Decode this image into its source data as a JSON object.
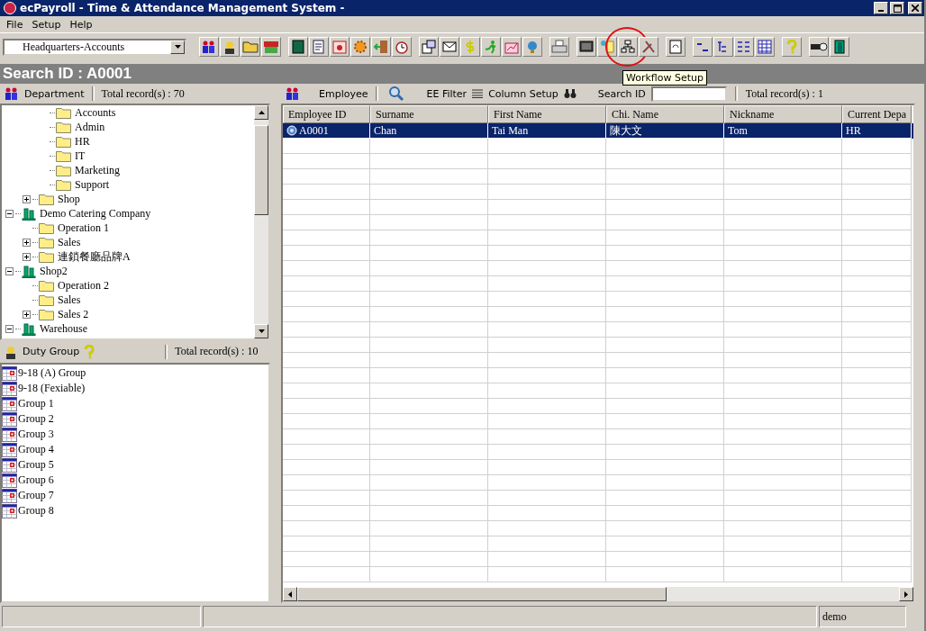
{
  "window": {
    "title": "ecPayroll - Time & Attendance Management System -"
  },
  "menu": [
    "File",
    "Setup",
    "Help"
  ],
  "toolbar": {
    "dropdown": {
      "value": "Headquarters-Accounts"
    },
    "groups": [
      [
        {
          "kind": "people"
        },
        {
          "kind": "person"
        },
        {
          "kind": "folder"
        },
        {
          "kind": "shop"
        }
      ],
      [
        {
          "kind": "book"
        },
        {
          "kind": "document"
        },
        {
          "kind": "calendar"
        },
        {
          "kind": "gear"
        },
        {
          "kind": "door"
        },
        {
          "kind": "clock"
        }
      ],
      [
        {
          "kind": "window"
        },
        {
          "kind": "mail"
        },
        {
          "kind": "dollar"
        },
        {
          "kind": "runner"
        },
        {
          "kind": "chart"
        },
        {
          "kind": "globe"
        }
      ],
      [
        {
          "kind": "printer"
        }
      ],
      [
        {
          "kind": "monitor"
        },
        {
          "kind": "tools"
        },
        {
          "kind": "workflow",
          "tooltip": "Workflow Setup"
        },
        {
          "kind": "wrench"
        }
      ],
      [
        {
          "kind": "page"
        }
      ],
      [
        {
          "kind": "list"
        },
        {
          "kind": "tree"
        },
        {
          "kind": "outline"
        },
        {
          "kind": "table"
        }
      ],
      [
        {
          "kind": "help"
        }
      ],
      [
        {
          "kind": "key"
        },
        {
          "kind": "exit"
        }
      ]
    ]
  },
  "search_banner": "Search ID : A0001",
  "department_panel": {
    "title": "Department",
    "total": "Total record(s) : 70",
    "tree": [
      {
        "children": [
          {
            "children": [
              {
                "label": "Accounts",
                "kind": "folder"
              },
              {
                "label": "Admin",
                "kind": "folder"
              },
              {
                "label": "HR",
                "kind": "folder"
              },
              {
                "label": "IT",
                "kind": "folder"
              },
              {
                "label": "Marketing",
                "kind": "folder"
              },
              {
                "label": "Support",
                "kind": "folder"
              }
            ]
          },
          {
            "label": "Shop",
            "kind": "folder",
            "expanded": false
          }
        ]
      },
      {
        "label": "Demo Catering Company",
        "kind": "company",
        "expanded": true,
        "children": [
          {
            "label": "Operation 1",
            "kind": "folder"
          },
          {
            "label": "Sales",
            "kind": "folder",
            "expanded": false
          },
          {
            "label": "連鎖餐廳品牌A",
            "kind": "folder",
            "expanded": false
          }
        ]
      },
      {
        "label": "Shop2",
        "kind": "company",
        "expanded": true,
        "children": [
          {
            "label": "Operation 2",
            "kind": "folder"
          },
          {
            "label": "Sales",
            "kind": "folder"
          },
          {
            "label": "Sales 2",
            "kind": "folder",
            "expanded": false
          }
        ]
      },
      {
        "label": "Warehouse",
        "kind": "company",
        "expanded": true
      }
    ]
  },
  "duty_group_panel": {
    "title": "Duty Group",
    "total": "Total record(s) : 10",
    "items": [
      "9-18 (A) Group",
      "9-18 (Fexiable)",
      "Group 1",
      "Group 2",
      "Group 3",
      "Group 4",
      "Group 5",
      "Group 6",
      "Group 7",
      "Group 8"
    ]
  },
  "employee_panel": {
    "title": "Employee",
    "filter_label": "EE Filter",
    "column_setup_label": "Column Setup",
    "search_label": "Search ID",
    "total": "Total record(s) : 1",
    "table": {
      "columns": [
        "Employee ID",
        "Surname",
        "First Name",
        "Chi. Name",
        "Nickname",
        "Current Depa"
      ],
      "rows": [
        {
          "cells": [
            "A0001",
            "Chan",
            "Tai Man",
            "陳大文",
            "Tom",
            "HR"
          ],
          "selected": true
        }
      ]
    }
  },
  "status_bar": {
    "user": "demo"
  }
}
